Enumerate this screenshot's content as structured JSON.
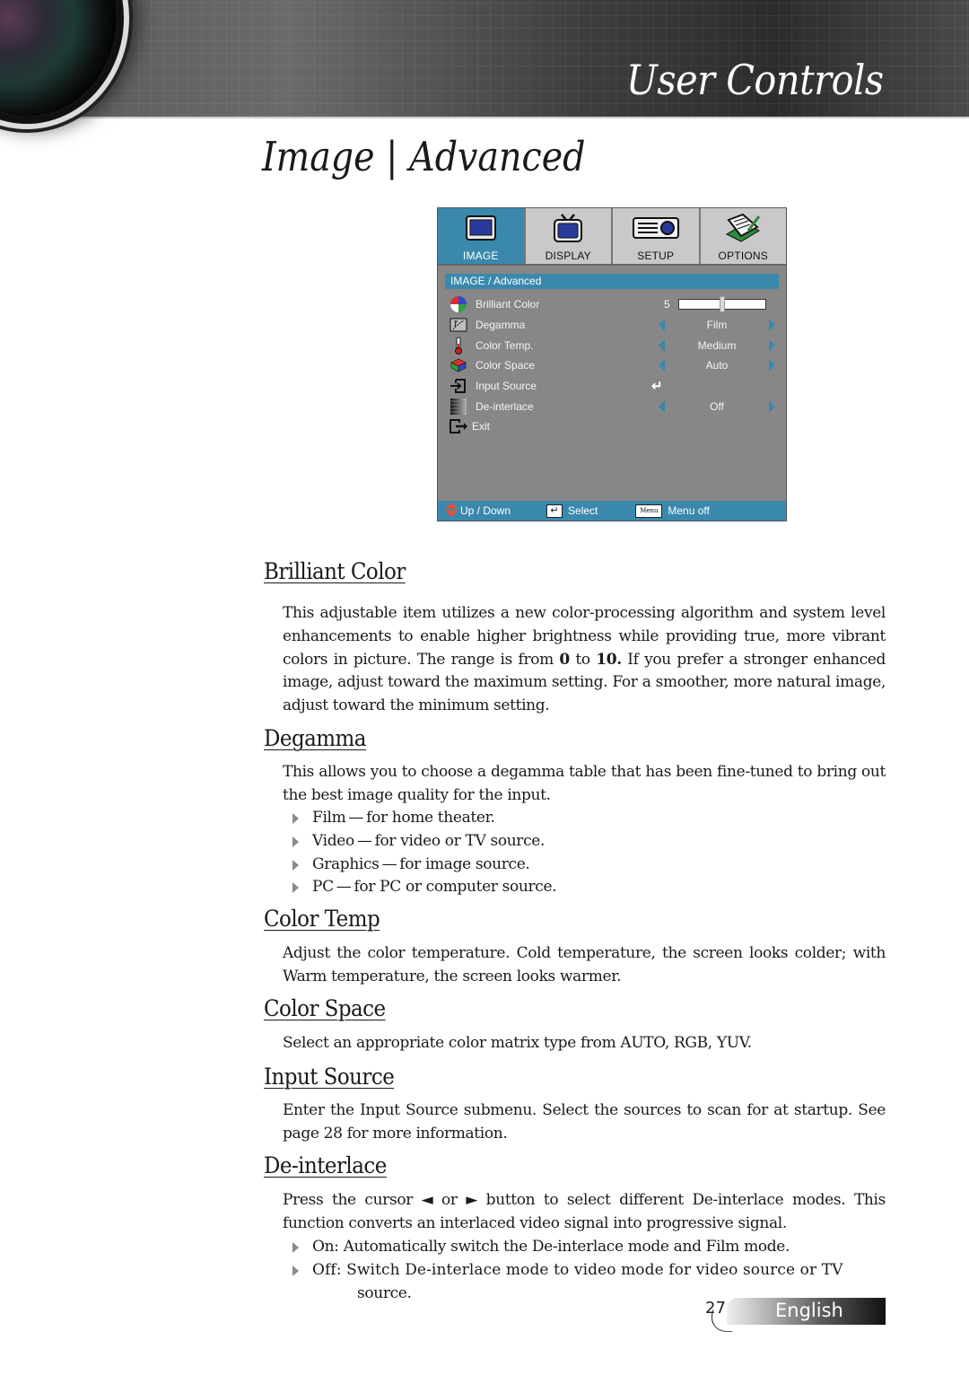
{
  "header": {
    "banner_title": "User Controls",
    "page_title": "Image | Advanced"
  },
  "osd": {
    "tabs": [
      {
        "label": "IMAGE",
        "icon": "monitor-icon",
        "active": true
      },
      {
        "label": "DISPLAY",
        "icon": "tv-icon",
        "active": false
      },
      {
        "label": "SETUP",
        "icon": "projector-icon",
        "active": false
      },
      {
        "label": "OPTIONS",
        "icon": "notepad-icon",
        "active": false
      }
    ],
    "breadcrumb": "IMAGE / Advanced",
    "items": [
      {
        "label": "Brilliant Color",
        "icon": "color-wheel-icon",
        "type": "slider",
        "value": "5",
        "level": 5,
        "max": 10
      },
      {
        "label": "Degamma",
        "icon": "gamma-curve-icon",
        "type": "select",
        "value": "Film"
      },
      {
        "label": "Color Temp.",
        "icon": "thermometer-icon",
        "type": "select",
        "value": "Medium"
      },
      {
        "label": "Color Space",
        "icon": "color-cube-icon",
        "type": "select",
        "value": "Auto"
      },
      {
        "label": "Input Source",
        "icon": "input-source-icon",
        "type": "enter",
        "value": "↵"
      },
      {
        "label": "De-interlace",
        "icon": "deinterlace-icon",
        "type": "select",
        "value": "Off"
      },
      {
        "label": "Exit",
        "icon": "exit-icon",
        "type": "action"
      }
    ],
    "footer": {
      "updown": "Up / Down",
      "select": "Select",
      "menu_key": "Menu",
      "menu_off": "Menu off",
      "enter_glyph": "↵"
    }
  },
  "sections": {
    "brilliant_color": {
      "heading": "Brilliant Color",
      "text_1": "This adjustable item utilizes a new color-processing algorithm and system level enhancements to enable higher brightness while providing true, more vibrant colors in picture. The range is from ",
      "min": "0",
      "text_2": " to ",
      "max": "10.",
      "text_3": " If you prefer a stronger enhanced image, adjust toward the maximum setting. For a smoother, more natural image, adjust toward the minimum setting."
    },
    "degamma": {
      "heading": "Degamma",
      "text": "This allows you to choose a degamma table that has been fine-tuned to bring out the best image quality for the input.",
      "bullets": [
        "Film — for home theater.",
        "Video — for video or TV source.",
        "Graphics — for image source.",
        "PC — for PC or computer source."
      ]
    },
    "color_temp": {
      "heading": "Color Temp",
      "text": "Adjust the color temperature. Cold temperature, the screen looks colder; with Warm temperature, the screen looks warmer."
    },
    "color_space": {
      "heading": "Color Space",
      "text": "Select an appropriate color matrix type from AUTO, RGB, YUV."
    },
    "input_source": {
      "heading": "Input Source",
      "text": "Enter the Input Source submenu. Select the sources to scan for at startup. See page 28 for more information."
    },
    "deinterlace": {
      "heading": "De-interlace",
      "text": "Press the cursor ◄ or ► button to select different De-interlace modes. This function converts an interlaced video signal into progressive signal.",
      "bullets": [
        "On: Automatically switch the De-interlace mode and Film mode.",
        "Off: Switch De-interlace mode to video mode for video source or TV"
      ],
      "bullet_continuation": "source."
    }
  },
  "footer": {
    "page_number": "27",
    "language": "English"
  },
  "colors": {
    "osd_accent": "#3a89ad",
    "osd_background": "#878787",
    "osd_tab_inactive": "#c9c9c9"
  }
}
